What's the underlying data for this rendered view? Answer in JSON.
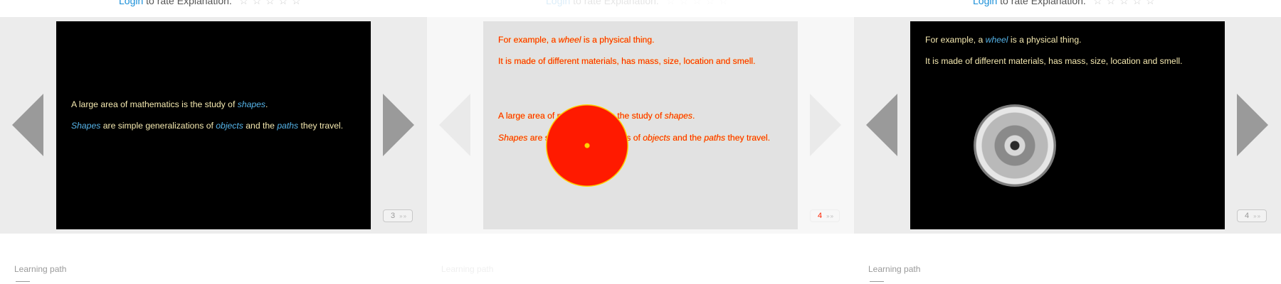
{
  "panels": [
    {
      "rate": {
        "login": "Login",
        "text": " to rate Explanation.",
        "stars": "☆☆☆☆☆"
      },
      "slide": {
        "line1_pre": "A large area of mathematics is the study of ",
        "line1_hl": "shapes",
        "line1_post": ".",
        "line2_a": "Shapes",
        "line2_b": " are simple generalizations of ",
        "line2_c": "objects",
        "line2_d": " and the ",
        "line2_e": "paths",
        "line2_f": " they travel."
      },
      "counter": {
        "page": "3",
        "more": "»»"
      },
      "learning_path": "Learning path"
    },
    {
      "rate": {
        "login": "Login",
        "text": " to rate Explanation.",
        "stars": "☆☆☆☆☆"
      },
      "slide": {
        "ex_pre": "For example, a ",
        "ex_hl": "wheel",
        "ex_post": " is a physical thing.",
        "made": "It is made of different materials, has mass, size, location and smell.",
        "line1_pre": "A large area of mathematics is the study of ",
        "line1_hl": "shapes",
        "line1_post": ".",
        "line2_a": "Shapes",
        "line2_b": " are simple generalizations of ",
        "line2_c": "objects",
        "line2_d": " and the ",
        "line2_e": "paths",
        "line2_f": " they travel."
      },
      "counter": {
        "page": "4",
        "more": "»»"
      },
      "learning_path": "Learning path"
    },
    {
      "rate": {
        "login": "Login",
        "text": " to rate Explanation.",
        "stars": "☆☆☆☆☆"
      },
      "slide": {
        "ex_pre": "For example, a ",
        "ex_hl": "wheel",
        "ex_post": " is a physical thing.",
        "made": "It is made of different materials, has mass, size, location and smell."
      },
      "counter": {
        "page": "4",
        "more": "»»"
      },
      "learning_path": "Learning path"
    }
  ],
  "icons": {
    "prev": "left-triangle-arrow",
    "next": "right-triangle-arrow",
    "stars": "empty-star-rating",
    "wheel": "car-wheel-image"
  },
  "colors": {
    "link": "#1a8fd8",
    "slide_bg": "#000000",
    "slide_text": "#f5e9b0",
    "highlight": "#56b4e9",
    "arrow": "#9a9a9a"
  }
}
